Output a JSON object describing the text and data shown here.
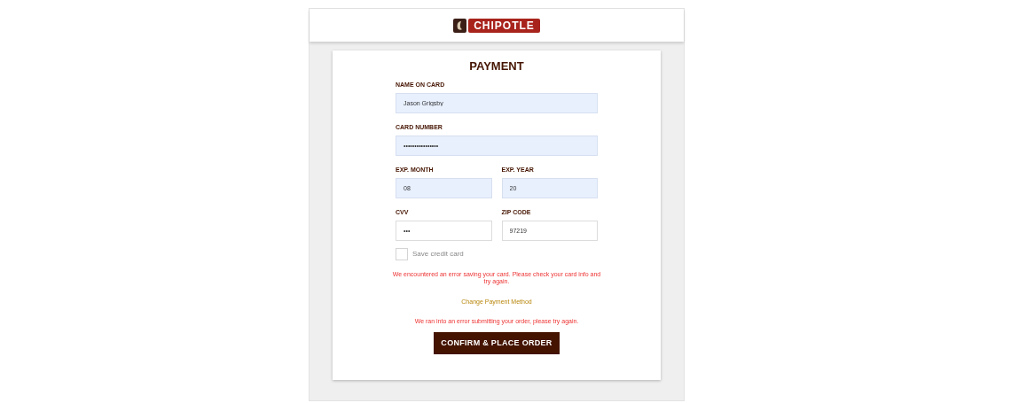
{
  "header": {
    "logo_text": "CHIPOTLE"
  },
  "form": {
    "title": "PAYMENT",
    "rows": [
      [
        {
          "label": "NAME ON CARD",
          "value": "Jason Grigsby",
          "autofilled": true
        }
      ],
      [
        {
          "label": "CARD NUMBER",
          "value": "••••••••••••••••",
          "autofilled": true
        }
      ],
      [
        {
          "label": "EXP. MONTH",
          "value": "08",
          "autofilled": true
        },
        {
          "label": "EXP. YEAR",
          "value": "20",
          "autofilled": true
        }
      ],
      [
        {
          "label": "CVV",
          "value": "•••",
          "autofilled": false
        },
        {
          "label": "ZIP CODE",
          "value": "97219",
          "autofilled": false
        }
      ]
    ],
    "save_card": {
      "label": "Save credit card",
      "checked": false
    },
    "card_error": "We encountered an error saving your card. Please check your card info and try again.",
    "change_link": "Change Payment Method",
    "order_error": "We ran into an error submitting your order, please try again.",
    "submit": "CONFIRM & PLACE ORDER"
  }
}
